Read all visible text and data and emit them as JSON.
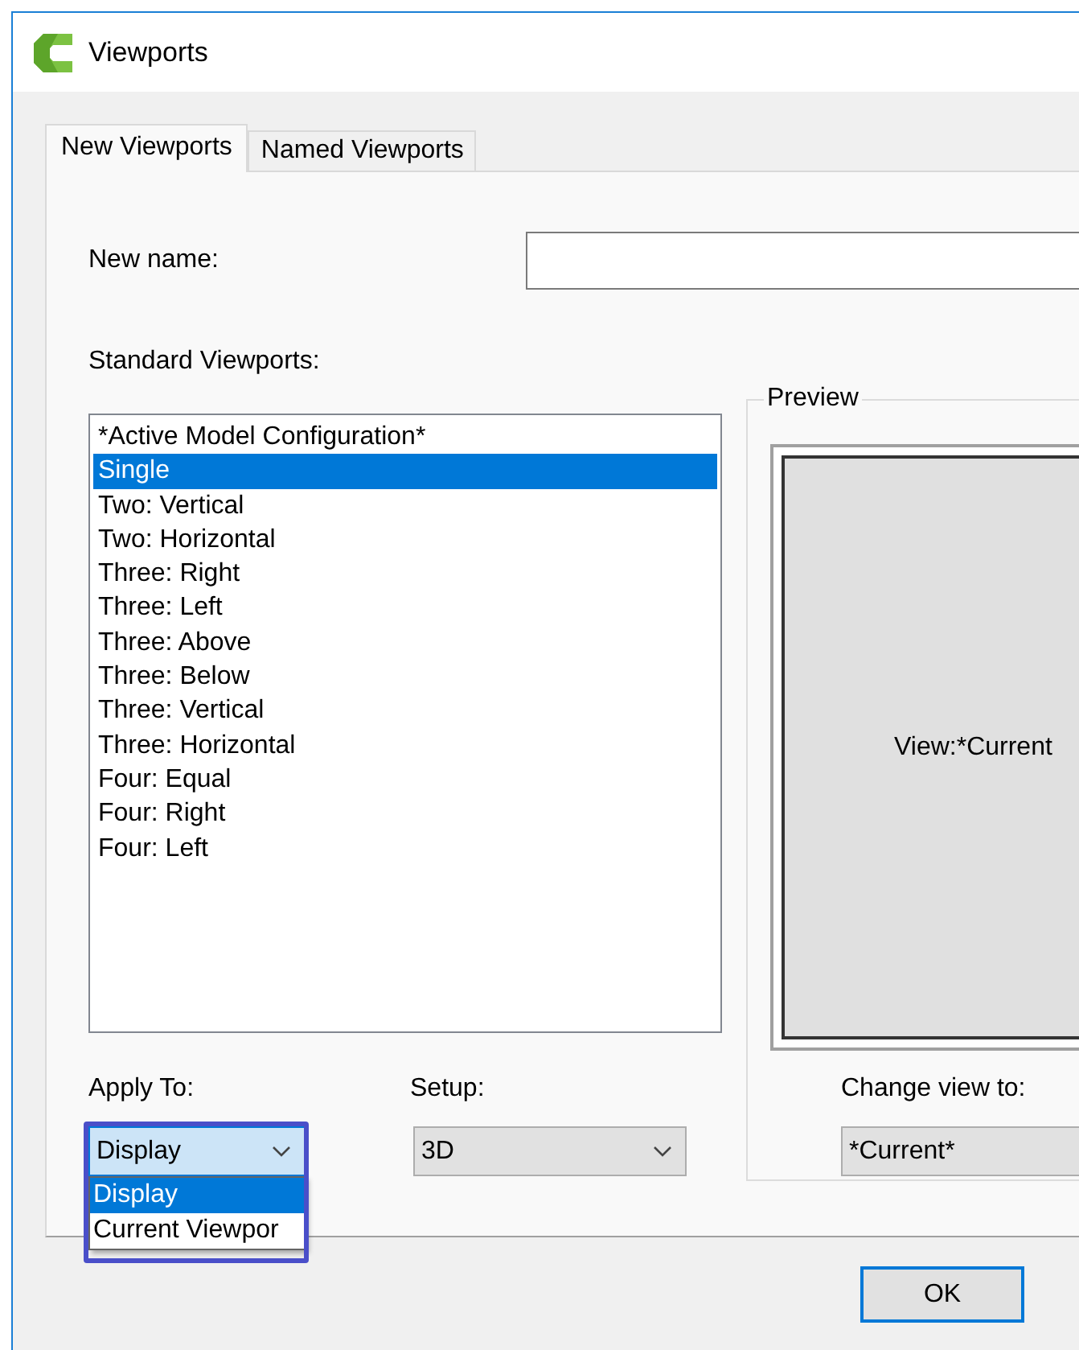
{
  "window": {
    "title": "Viewports"
  },
  "tabs": [
    {
      "label": "New Viewports",
      "selected": true
    },
    {
      "label": "Named Viewports",
      "selected": false
    }
  ],
  "new_name": {
    "label": "New name:"
  },
  "standard_viewports": {
    "label": "Standard Viewports:",
    "items": [
      {
        "label": "*Active Model Configuration*",
        "selected": false
      },
      {
        "label": "Single",
        "selected": true
      },
      {
        "label": "Two: Vertical",
        "selected": false
      },
      {
        "label": "Two: Horizontal",
        "selected": false
      },
      {
        "label": "Three: Right",
        "selected": false
      },
      {
        "label": "Three: Left",
        "selected": false
      },
      {
        "label": "Three: Above",
        "selected": false
      },
      {
        "label": "Three: Below",
        "selected": false
      },
      {
        "label": "Three: Vertical",
        "selected": false
      },
      {
        "label": "Three: Horizontal",
        "selected": false
      },
      {
        "label": "Four: Equal",
        "selected": false
      },
      {
        "label": "Four: Right",
        "selected": false
      },
      {
        "label": "Four: Left",
        "selected": false
      }
    ]
  },
  "preview": {
    "label": "Preview",
    "text": "View:*Current"
  },
  "apply_to": {
    "label": "Apply To:",
    "value": "Display",
    "expanded": true,
    "highlighted": true,
    "options": [
      {
        "label": "Display",
        "selected": true
      },
      {
        "label": "Current Viewpor",
        "selected": false
      }
    ]
  },
  "setup": {
    "label": "Setup:",
    "value": "3D"
  },
  "change_view_to": {
    "label": "Change view to:",
    "value": "*Current*"
  },
  "buttons": [
    {
      "label": "OK",
      "default": true
    }
  ]
}
